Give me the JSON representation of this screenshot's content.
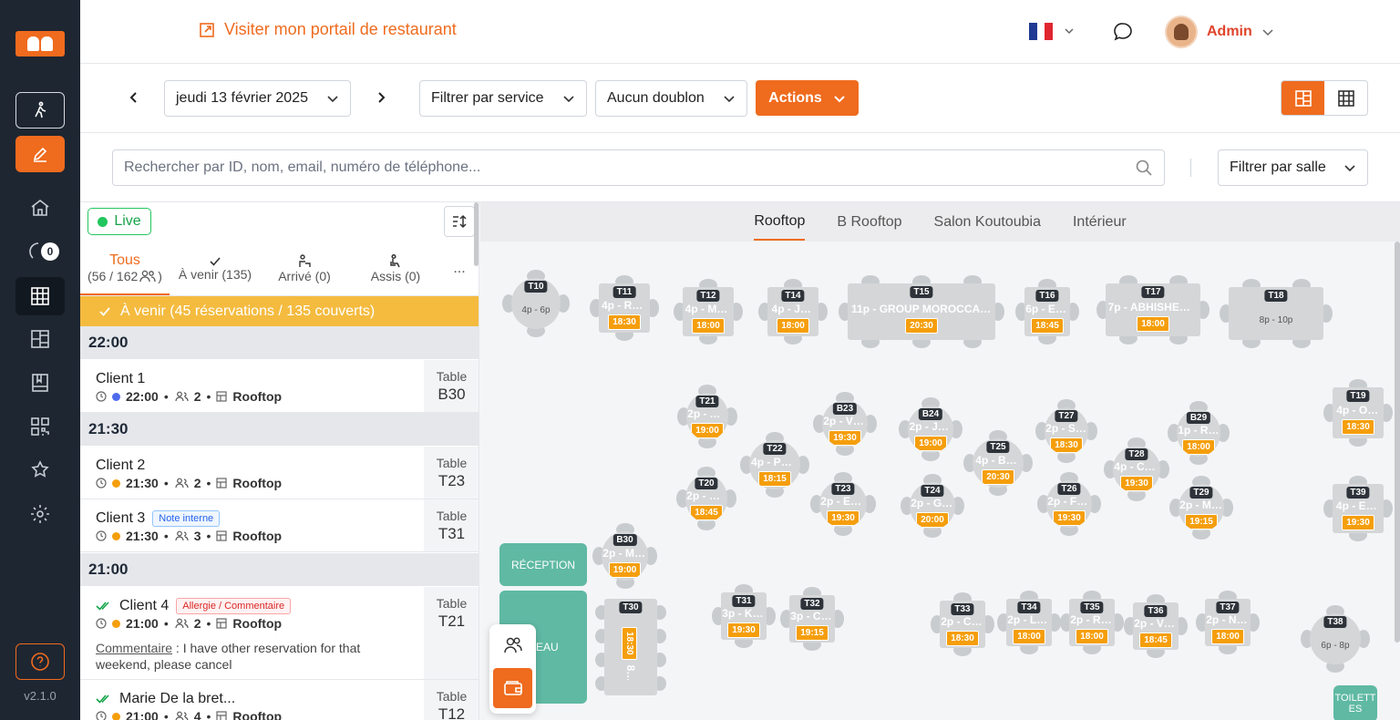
{
  "app": {
    "version": "v2.1.0",
    "sidebar_badge": "0"
  },
  "topbar": {
    "portal_link": "Visiter mon portail de restaurant",
    "user": "Admin"
  },
  "controls": {
    "date": "jeudi 13 février 2025",
    "service_filter": "Filtrer par service",
    "duplicate_filter": "Aucun doublon",
    "actions": "Actions"
  },
  "search": {
    "placeholder": "Rechercher par ID, nom, email, numéro de téléphone...",
    "room_filter": "Filtrer par salle"
  },
  "left": {
    "live": "Live",
    "tabs": [
      {
        "label": "Tous",
        "sub": "(56 / 162"
      },
      {
        "label": "À venir (135)"
      },
      {
        "label": "Arrivé (0)"
      },
      {
        "label": "Assis (0)"
      },
      {
        "label": "..."
      }
    ],
    "upcoming_banner": "À venir (45 réservations / 135 couverts)",
    "groups": [
      {
        "time": "22:00"
      },
      {
        "time": "21:30"
      },
      {
        "time": "21:00"
      }
    ],
    "reservations": [
      {
        "name": "Client 1",
        "time": "22:00",
        "guests": "2",
        "room": "Rooftop",
        "table_label": "Table",
        "table": "B30"
      },
      {
        "name": "Client 2",
        "time": "21:30",
        "guests": "2",
        "room": "Rooftop",
        "table_label": "Table",
        "table": "T23"
      },
      {
        "name": "Client 3",
        "time": "21:30",
        "guests": "3",
        "room": "Rooftop",
        "table_label": "Table",
        "table": "T31",
        "badge": "Note interne"
      },
      {
        "name": "Client 4",
        "time": "21:00",
        "guests": "2",
        "room": "Rooftop",
        "table_label": "Table",
        "table": "T21",
        "badge": "Allergie / Commentaire",
        "comment_label": "Commentaire",
        "comment": " : I have other reservation for that weekend, please cancel"
      },
      {
        "name": "Marie De la bret...",
        "time": "21:00",
        "guests": "4",
        "room": "Rooftop",
        "table_label": "Table",
        "table": "T12"
      }
    ]
  },
  "floor": {
    "rooms": [
      "Rooftop",
      "B Rooftop",
      "Salon Koutoubia",
      "Intérieur"
    ],
    "zones": {
      "reception": "RÉCEPTION",
      "bureau": "REAU",
      "toilettes": "TOILETT ES"
    },
    "tables": [
      {
        "id": "T10",
        "label": "",
        "time": "",
        "cap": "4p - 6p"
      },
      {
        "id": "T11",
        "label": "4p - RO...",
        "time": "18:30"
      },
      {
        "id": "T12",
        "label": "4p - MA...",
        "time": "18:00"
      },
      {
        "id": "T14",
        "label": "4p - JE...",
        "time": "18:00"
      },
      {
        "id": "T15",
        "label": "11p - GROUP MOROCCAN AD...",
        "time": "20:30"
      },
      {
        "id": "T16",
        "label": "6p - EM...",
        "time": "18:45"
      },
      {
        "id": "T17",
        "label": "7p - ABHISHEK CH...",
        "time": "18:00"
      },
      {
        "id": "T18",
        "label": "",
        "time": "",
        "cap": "8p - 10p"
      },
      {
        "id": "T21",
        "label": "2p - AN...",
        "time": "19:00"
      },
      {
        "id": "B23",
        "label": "2p - VIK...",
        "time": "19:30"
      },
      {
        "id": "B24",
        "label": "2p - JE...",
        "time": "19:00"
      },
      {
        "id": "T27",
        "label": "2p - SO...",
        "time": "18:30"
      },
      {
        "id": "B29",
        "label": "1p - REN...",
        "time": "18:00"
      },
      {
        "id": "T19",
        "label": "4p - OT...",
        "time": "18:30"
      },
      {
        "id": "T22",
        "label": "4p - PHI...",
        "time": "18:15"
      },
      {
        "id": "T25",
        "label": "4p - BR...",
        "time": "20:30"
      },
      {
        "id": "T28",
        "label": "4p - CH...",
        "time": "19:30"
      },
      {
        "id": "T20",
        "label": "2p - SA...",
        "time": "18:45"
      },
      {
        "id": "T23",
        "label": "2p - EMI...",
        "time": "19:30"
      },
      {
        "id": "T24",
        "label": "2p - GR...",
        "time": "20:00"
      },
      {
        "id": "T26",
        "label": "2p - FEL...",
        "time": "19:30"
      },
      {
        "id": "T29",
        "label": "2p - ME...",
        "time": "19:15"
      },
      {
        "id": "T39",
        "label": "4p - ES...",
        "time": "19:30"
      },
      {
        "id": "B30",
        "label": "2p - MA...",
        "time": "19:00"
      },
      {
        "id": "T30",
        "label": "8p - LAURIE MART...",
        "time": "18:30"
      },
      {
        "id": "T31",
        "label": "3p - KA...",
        "time": "19:30"
      },
      {
        "id": "T32",
        "label": "3p - CRI...",
        "time": "19:15"
      },
      {
        "id": "T33",
        "label": "2p - CO...",
        "time": "18:30"
      },
      {
        "id": "T34",
        "label": "2p - LU...",
        "time": "18:00"
      },
      {
        "id": "T35",
        "label": "2p - RO...",
        "time": "18:00"
      },
      {
        "id": "T36",
        "label": "2p - VIK...",
        "time": "18:45"
      },
      {
        "id": "T37",
        "label": "2p - NE...",
        "time": "18:00"
      },
      {
        "id": "T38",
        "label": "",
        "time": "",
        "cap": "6p - 8p"
      }
    ]
  },
  "colors": {
    "accent": "#ef6b1e",
    "sidebar": "#1e2631",
    "upcoming": "#f4bb3f",
    "time_badge": "#f59e0b",
    "zone": "#5fb9a3"
  }
}
